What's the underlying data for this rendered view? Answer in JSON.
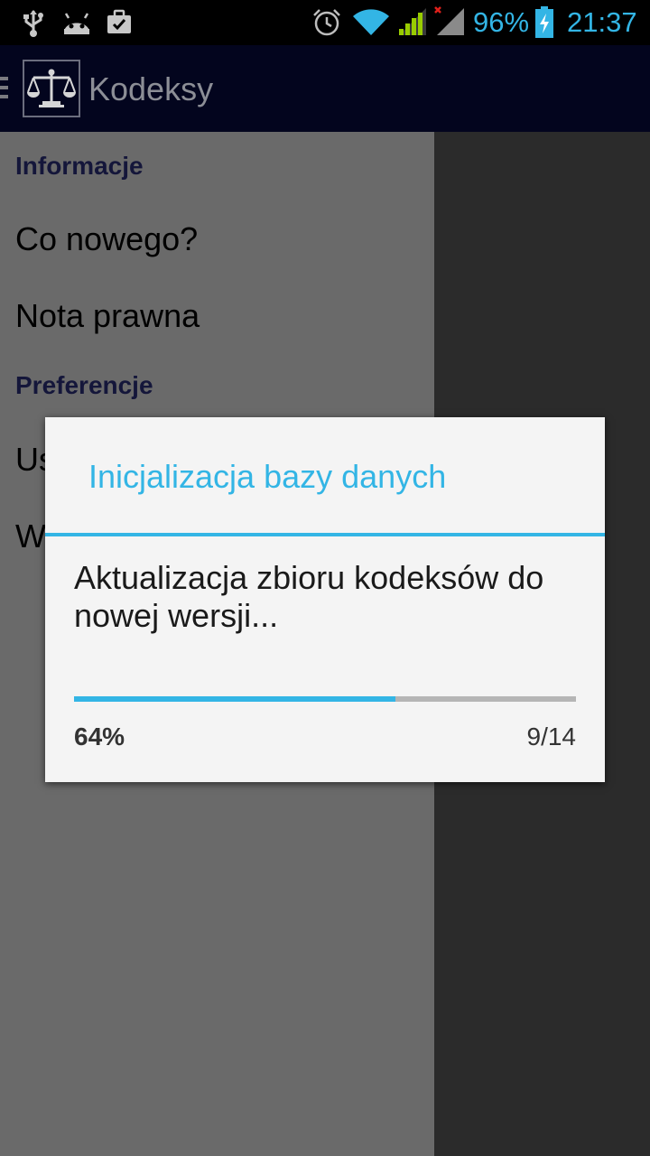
{
  "status_bar": {
    "battery_percent": "96%",
    "time": "21:37",
    "icons": [
      "usb-icon",
      "android-debug-icon",
      "briefcase-icon",
      "alarm-icon",
      "wifi-icon",
      "signal-icon",
      "signal-no-sim-icon",
      "battery-charging-icon"
    ],
    "accent_color": "#33b5e5"
  },
  "action_bar": {
    "title": "Kodeksy",
    "logo_icon": "scales-of-justice-icon",
    "drawer_icon": "drawer-indicator-icon"
  },
  "drawer": {
    "sections": [
      {
        "header": "Informacje",
        "items": [
          "Co nowego?",
          "Nota prawna"
        ]
      },
      {
        "header": "Preferencje",
        "items": [
          "Us",
          "W"
        ]
      }
    ]
  },
  "dialog": {
    "title": "Inicjalizacja bazy danych",
    "message": "Aktualizacja zbioru kodeksów do nowej wersji...",
    "progress_fraction": 0.64,
    "progress_percent_label": "64%",
    "progress_count_label": "9/14"
  }
}
